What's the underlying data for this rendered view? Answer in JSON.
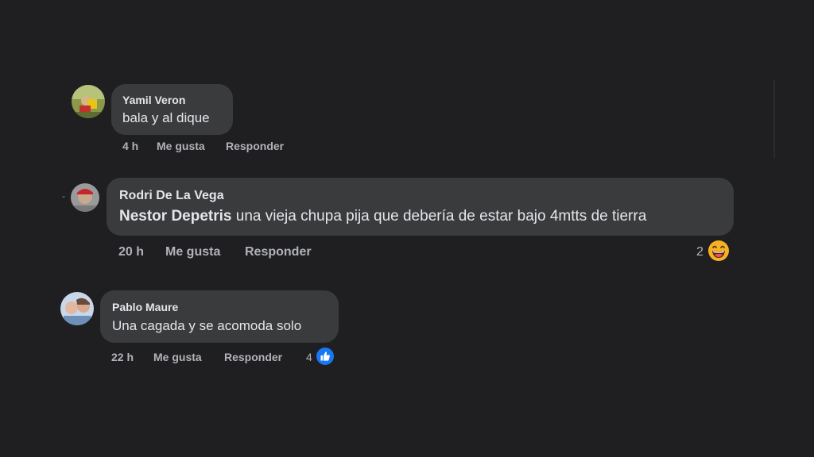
{
  "comments": [
    {
      "author": "Yamil Veron",
      "text": "bala y al dique",
      "time": "4 h",
      "like_label": "Me gusta",
      "reply_label": "Responder"
    },
    {
      "thread_marker": "-",
      "author": "Rodri De La Vega",
      "mention": "Nestor Depetris",
      "text": " una vieja chupa pija que debería de estar bajo 4mtts de tierra",
      "time": "20 h",
      "like_label": "Me gusta",
      "reply_label": "Responder",
      "reaction_count": "2",
      "reaction_icon": "laughing-emoji-icon"
    },
    {
      "author": "Pablo Maure",
      "text": "Una cagada y se acomoda solo",
      "time": "22 h",
      "like_label": "Me gusta",
      "reply_label": "Responder",
      "reaction_count": "4",
      "reaction_icon": "thumbs-up-icon"
    }
  ],
  "colors": {
    "background": "#1f1f21",
    "bubble": "#3a3b3c",
    "text": "#e4e6eb",
    "secondary_text": "#b0b3b8",
    "like_blue": "#1877f2",
    "emoji_yellow": "#f7b125"
  }
}
